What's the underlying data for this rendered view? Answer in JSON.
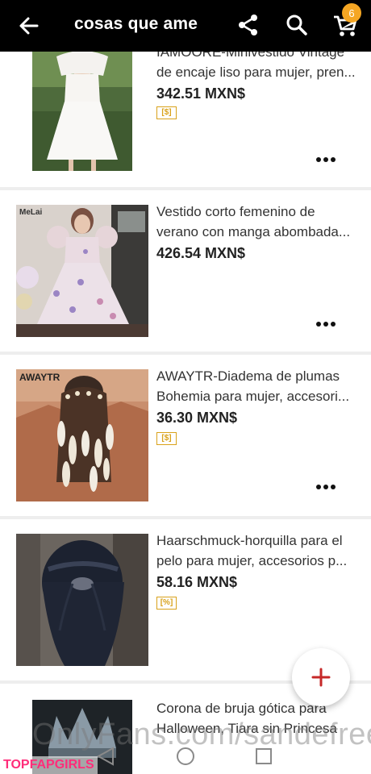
{
  "header": {
    "title": "cosas que ame",
    "cart_count": "6"
  },
  "items": [
    {
      "name_line1": "IAMOORE-Minivestido Vintage",
      "name_line2": "de encaje liso para mujer, pren...",
      "price": "342.51 MXN$",
      "tag": "[$]",
      "image_icon": "white-lace-dress-photo"
    },
    {
      "name_line1": "Vestido corto femenino de",
      "name_line2": "verano con manga abombada...",
      "price": "426.54 MXN$",
      "image_label": "MeLai",
      "image_icon": "floral-dress-photo"
    },
    {
      "name_line1": "AWAYTR-Diadema de plumas",
      "name_line2": "Bohemia para mujer, accesori...",
      "price": "36.30 MXN$",
      "tag": "[$]",
      "image_label": "AWAYTR",
      "image_icon": "feather-headband-photo"
    },
    {
      "name_line1": "Haarschmuck-horquilla para el",
      "name_line2": "pelo para mujer, accesorios p...",
      "price": "58.16 MXN$",
      "tag": "[%]",
      "image_icon": "hair-clip-photo"
    },
    {
      "name_line1": "Corona de bruja gótica para",
      "name_line2": "Halloween, Tiara sin Princesa",
      "image_icon": "gothic-crown-photo"
    }
  ],
  "watermark": "OnlyFans.com/sandefree",
  "brand": "TOPFAPGIRLS",
  "colors": {
    "topbar": "#000000",
    "badge": "#f5a623",
    "tag": "#d9a21b",
    "fab_plus": "#c62828"
  }
}
